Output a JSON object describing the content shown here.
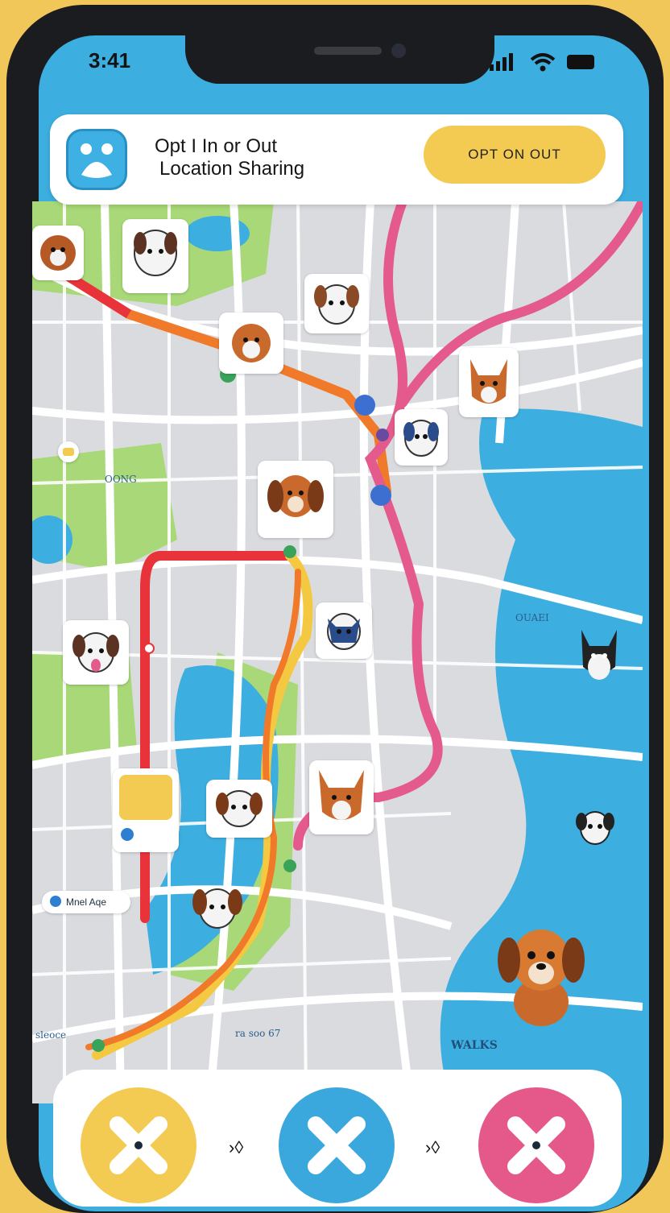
{
  "status_bar": {
    "time": "3:41"
  },
  "header": {
    "title_line1": "Opt I In or Out",
    "title_line2": "Location Sharing",
    "button_label": "OPT ON OUT"
  },
  "map": {
    "labels": {
      "park": "OONG",
      "lake_right": "OUAEI",
      "marker_left": "Mnel Aqe",
      "river": "WALKS",
      "road_bottom": "ra soo 67",
      "bottom_left": "sleoce"
    }
  },
  "bottom_bar": {
    "arrow_1": "›◊",
    "arrow_2": "›◊"
  },
  "colors": {
    "water": "#3daee0",
    "road": "#ffffff",
    "block": "#d9dbdf",
    "park": "#a8d877",
    "route_red": "#e8333a",
    "route_orange": "#f07a2a",
    "route_yellow": "#f5c842",
    "route_pink": "#e45a8c",
    "button_yellow": "#f3cb52",
    "button_blue": "#3aa8dc",
    "button_pink": "#e4588a"
  }
}
